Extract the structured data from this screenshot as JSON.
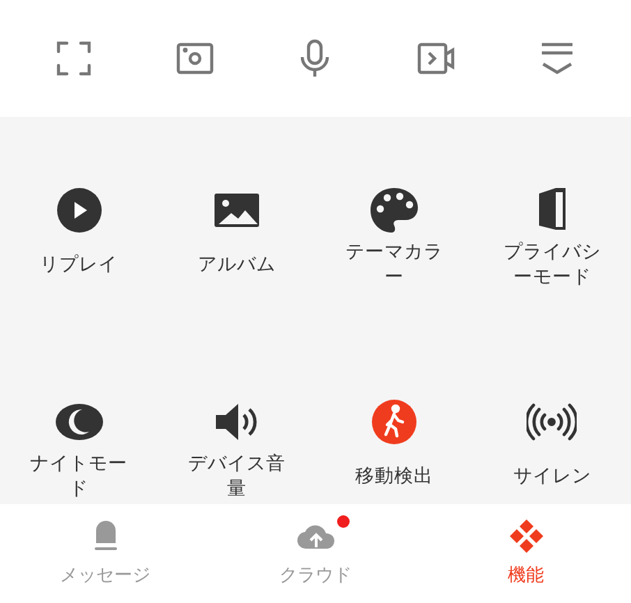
{
  "toolbar": [
    {
      "kind": "fullscreen"
    },
    {
      "kind": "snapshot"
    },
    {
      "kind": "microphone"
    },
    {
      "kind": "record"
    },
    {
      "kind": "collapse"
    }
  ],
  "features": [
    {
      "kind": "play",
      "label": "リプレイ",
      "active": false
    },
    {
      "kind": "image",
      "label": "アルバム",
      "active": false
    },
    {
      "kind": "palette",
      "label": "テーマカラー",
      "active": false
    },
    {
      "kind": "privacy",
      "label": "プライバシーモード",
      "active": false
    },
    {
      "kind": "moon",
      "label": "ナイトモード",
      "active": false
    },
    {
      "kind": "speaker",
      "label": "デバイス音量",
      "active": false
    },
    {
      "kind": "walker",
      "label": "移動検出",
      "active": true
    },
    {
      "kind": "siren",
      "label": "サイレン",
      "active": false
    }
  ],
  "tabs": [
    {
      "kind": "bell",
      "label": "メッセージ",
      "selected": false,
      "badge": false
    },
    {
      "kind": "cloud",
      "label": "クラウド",
      "selected": false,
      "badge": true
    },
    {
      "kind": "grid",
      "label": "機能",
      "selected": true,
      "badge": false
    }
  ]
}
